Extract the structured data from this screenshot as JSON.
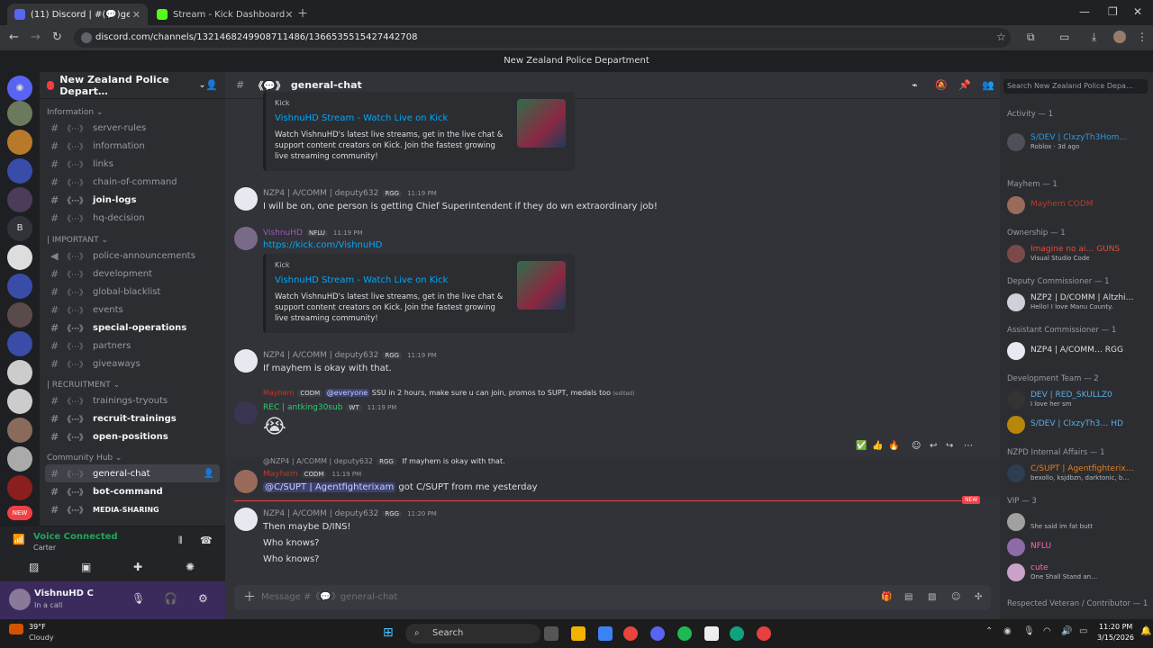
{
  "browser": {
    "tabs": [
      {
        "label": "(11) Discord | #(💬)gener…",
        "active": true
      },
      {
        "label": "Stream - Kick Dashboard",
        "active": false
      }
    ],
    "url": "discord.com/channels/1321468249908711486/1366535515427442708"
  },
  "discord_title": "New Zealand Police Department",
  "server": {
    "name": "New Zealand Police Depart…",
    "categories": [
      {
        "name": "Information",
        "channels": [
          {
            "label": "server-rules",
            "bold": false
          },
          {
            "label": "information",
            "bold": false
          },
          {
            "label": "links",
            "bold": false
          },
          {
            "label": "chain-of-command",
            "bold": false
          },
          {
            "label": "join-logs",
            "bold": true
          },
          {
            "label": "hq-decision",
            "bold": false
          }
        ]
      },
      {
        "name": "| IMPORTANT",
        "channels": [
          {
            "label": "police-announcements",
            "bold": false
          },
          {
            "label": "development",
            "bold": false
          },
          {
            "label": "global-blacklist",
            "bold": false
          },
          {
            "label": "events",
            "bold": false
          },
          {
            "label": "special-operations",
            "bold": true
          },
          {
            "label": "partners",
            "bold": false
          },
          {
            "label": "giveaways",
            "bold": false
          }
        ]
      },
      {
        "name": "| RECRUITMENT",
        "channels": [
          {
            "label": "trainings-tryouts",
            "bold": false
          },
          {
            "label": "recruit-trainings",
            "bold": true
          },
          {
            "label": "open-positions",
            "bold": true
          }
        ]
      },
      {
        "name": "Community Hub",
        "channels": [
          {
            "label": "general-chat",
            "bold": true
          },
          {
            "label": "bot-command",
            "bold": true
          },
          {
            "label": "MEDIA-SHARING",
            "bold": true
          }
        ]
      }
    ]
  },
  "voice": {
    "status": "Voice Connected",
    "channel": "Carter"
  },
  "user": {
    "name": "VishnuHD C",
    "status": "In a call"
  },
  "chat": {
    "channel": "general-chat",
    "embed1": {
      "provider": "Kick",
      "title": "VishnuHD Stream - Watch Live on Kick",
      "desc": "Watch VishnuHD's latest live streams, get in the live chat & support content creators on Kick. Join the fastest growing live streaming community!"
    },
    "m1": {
      "author": "NZP4 | A/COMM | deputy632",
      "tag": "RGG",
      "time": "11:19 PM",
      "text": "I will be on, one person is getting Chief Superintendent if they do wn extraordinary job!"
    },
    "m2": {
      "author": "VishnuHD",
      "tag": "NFLU",
      "time": "11:19 PM",
      "link": "https://kick.com/VishnuHD"
    },
    "m3": {
      "author": "NZP4 | A/COMM | deputy632",
      "tag": "RGG",
      "time": "11:19 PM",
      "text": "If mayhem is okay with that."
    },
    "m4": {
      "reply_author": "Mayhem",
      "reply_tag": "CODM",
      "reply_mention": "@everyone",
      "reply_text": "SSU in 2 hours, make sure u can join, promos to SUPT, medals too",
      "edited": "(edited)",
      "author": "REC | antking30sub",
      "tag": "WT",
      "time": "11:19 PM",
      "emoji": "😭"
    },
    "m5": {
      "reply_author": "@NZP4 | A/COMM | deputy632",
      "reply_tag": "RGG",
      "reply_text": "If mayhem is okay with that.",
      "author": "Mayhem",
      "tag": "CODM",
      "time": "11:19 PM",
      "mention": "@C/SUPT | Agentfighterixam",
      "text": "got C/SUPT from me yesterday"
    },
    "new_badge": "NEW",
    "m6": {
      "author": "NZP4 | A/COMM | deputy632",
      "tag": "RGG",
      "time": "11:20 PM",
      "lines": [
        "Then maybe D/INS!",
        "Who knows?",
        "Who knows?"
      ]
    },
    "composer_placeholder": "Message #《💬》general-chat"
  },
  "members": {
    "search_placeholder": "Search New Zealand Police Depa…",
    "groups": [
      {
        "title": "Activity — 1",
        "items": [
          {
            "name": "S/DEV | ClxzyTh3Hom…",
            "sub": "Roblox · 3d ago"
          }
        ]
      },
      {
        "title": "Mayhem — 1",
        "items": [
          {
            "name": "Mayhem  CODM",
            "sub": ""
          }
        ]
      },
      {
        "title": "Ownership — 1",
        "items": [
          {
            "name": "Imagine no ai…  GUNS",
            "sub": "Visual Studio Code"
          }
        ]
      },
      {
        "title": "Deputy Commissioner — 1",
        "items": [
          {
            "name": "NZP2 | D/COMM | Altzhi…",
            "sub": "Hello! I love Manu County."
          }
        ]
      },
      {
        "title": "Assistant Commissioner — 1",
        "items": [
          {
            "name": "NZP4 | A/COMM…  RGG",
            "sub": ""
          }
        ]
      },
      {
        "title": "Development Team — 2",
        "items": [
          {
            "name": "DEV | RED_SKULLZ0",
            "sub": "I love her sm"
          },
          {
            "name": "S/DEV | ClxzyTh3…  HD",
            "sub": ""
          }
        ]
      },
      {
        "title": "NZPD Internal Affairs — 1",
        "items": [
          {
            "name": "C/SUPT | Agentfighterix…",
            "sub": "bexollo, ksjdbzn, darktonic, b…"
          }
        ]
      },
      {
        "title": "VIP — 3",
        "items": [
          {
            "name": "",
            "sub": "She said im fat butt"
          },
          {
            "name": "  NFLU",
            "sub": ""
          },
          {
            "name": "  cute",
            "sub": "One Shall Stand an…"
          }
        ]
      },
      {
        "title": "Respected Veteran / Contributor — 1",
        "items": []
      }
    ]
  },
  "taskbar": {
    "weather_temp": "39°F",
    "weather_desc": "Cloudy",
    "search": "Search",
    "time": "11:20 PM",
    "date": "3/15/2026"
  }
}
